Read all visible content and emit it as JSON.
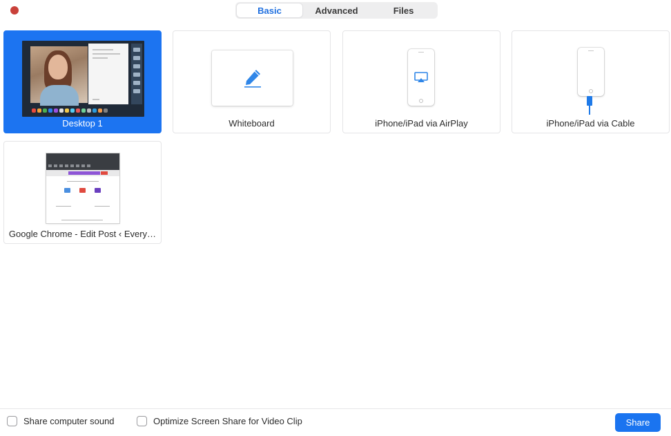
{
  "window": {
    "close_color": "#c9413a"
  },
  "tabs": [
    {
      "label": "Basic",
      "selected": true
    },
    {
      "label": "Advanced",
      "selected": false
    },
    {
      "label": "Files",
      "selected": false
    }
  ],
  "share_sources": [
    {
      "label": "Desktop 1",
      "selected": true,
      "icon": "desktop-thumbnail"
    },
    {
      "label": "Whiteboard",
      "selected": false,
      "icon": "pencil-icon"
    },
    {
      "label": "iPhone/iPad via AirPlay",
      "selected": false,
      "icon": "airplay-icon"
    },
    {
      "label": "iPhone/iPad via Cable",
      "selected": false,
      "icon": "cable-icon"
    },
    {
      "label": "Google Chrome - Edit Post ‹ Every…",
      "selected": false,
      "icon": "chrome-window-thumbnail"
    }
  ],
  "footer": {
    "share_sound_label": "Share computer sound",
    "share_sound_checked": false,
    "optimize_label": "Optimize Screen Share for Video Clip",
    "optimize_checked": false,
    "share_button_label": "Share"
  },
  "colors": {
    "accent": "#1c74f1",
    "selected_tab_text": "#1f6fdf"
  }
}
